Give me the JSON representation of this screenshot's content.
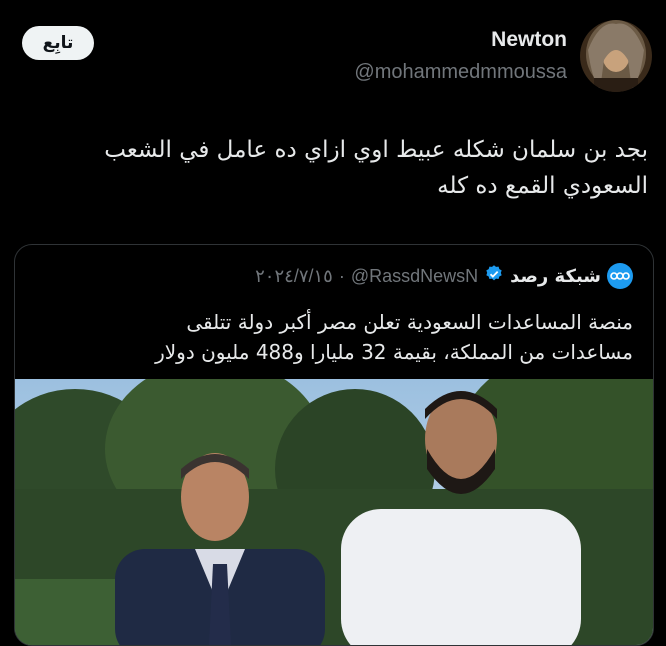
{
  "tweet": {
    "follow_label": "تابِع",
    "display_name": "Newton",
    "handle": "@mohammedmmoussa",
    "text_line1": "بجد بن سلمان شكله عبيط اوي ازاي ده عامل في الشعب",
    "text_line2": "السعودي القمع ده كله"
  },
  "quote": {
    "account_name": "شبكة رصد",
    "handle": "@RassdNewsN",
    "separator": "·",
    "date": "٢٠٢٤/٧/١٥",
    "text_line1": "منصة المساعدات السعودية تعلن مصر أكبر دولة تتلقى",
    "text_line2": "مساعدات من المملكة، بقيمة 32 مليارا و488 مليون دولار"
  },
  "colors": {
    "background": "#000000",
    "text": "#e7e9ea",
    "muted": "#71767b",
    "verified": "#1d9bf0",
    "follow_bg": "#eff3f4"
  },
  "icons": {
    "verified": "verified-badge-icon",
    "quote_avatar": "rassd-logo-icon"
  }
}
